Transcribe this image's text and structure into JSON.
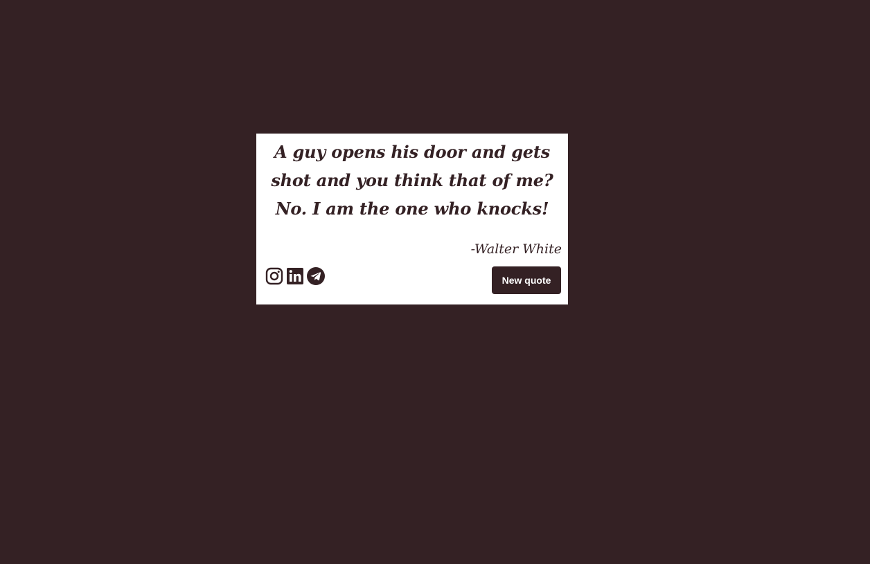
{
  "colors": {
    "background": "#342124",
    "card": "#ffffff",
    "accent": "#342124"
  },
  "quote": {
    "text": "A guy opens his door and gets shot and you think that of me? No. I am the one who knocks!",
    "author": "-Walter White"
  },
  "social": [
    {
      "name": "instagram",
      "icon": "instagram-icon"
    },
    {
      "name": "linkedin",
      "icon": "linkedin-icon"
    },
    {
      "name": "telegram",
      "icon": "telegram-icon"
    }
  ],
  "button": {
    "new_quote_label": "New quote"
  }
}
